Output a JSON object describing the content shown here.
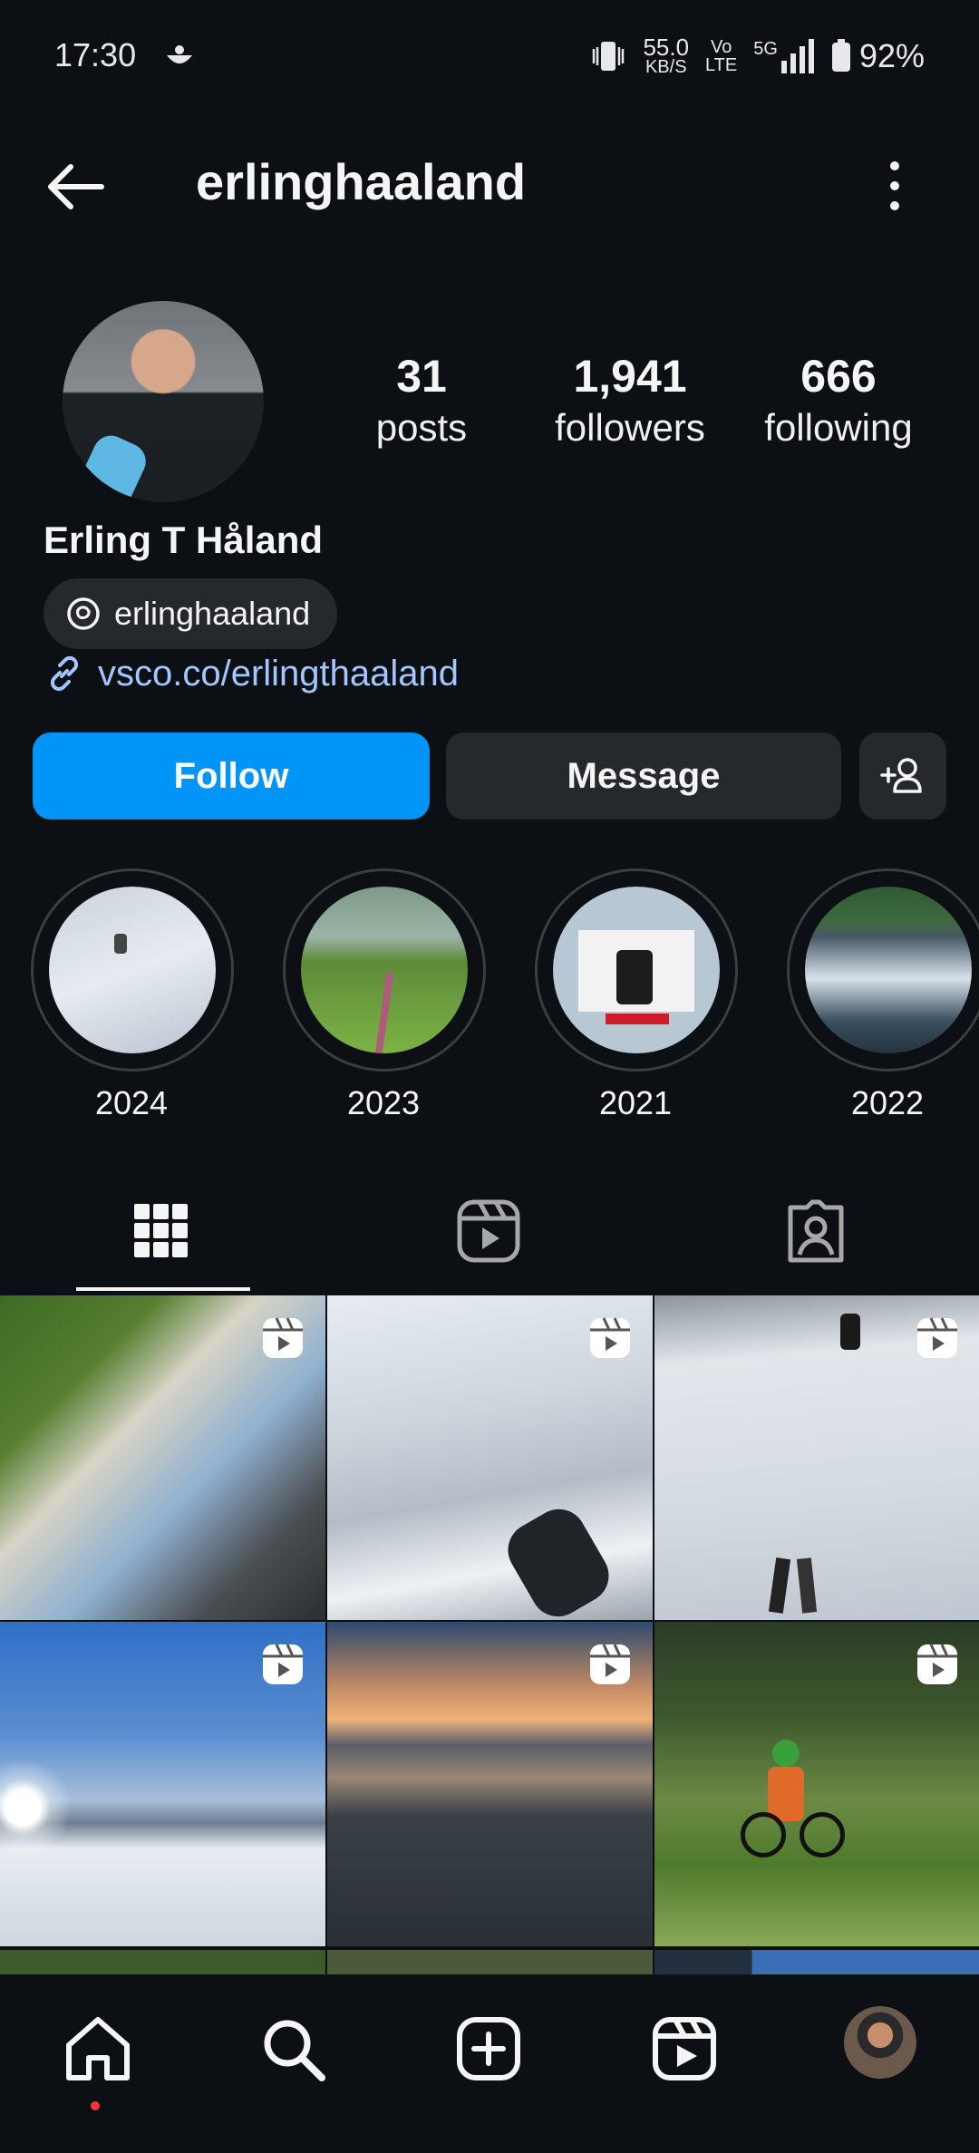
{
  "status_bar": {
    "time": "17:30",
    "net_speed": "55.0",
    "net_unit": "KB/S",
    "volte_top": "Vo",
    "volte_bottom": "LTE",
    "network": "5G",
    "battery": "92%"
  },
  "header": {
    "username": "erlinghaaland"
  },
  "profile": {
    "stats": [
      {
        "value": "31",
        "label": "posts"
      },
      {
        "value": "1,941",
        "label": "followers"
      },
      {
        "value": "666",
        "label": "following"
      }
    ],
    "full_name": "Erling T Håland",
    "threads_handle": "erlinghaaland",
    "link": "vsco.co/erlingthaaland"
  },
  "actions": {
    "follow": "Follow",
    "message": "Message"
  },
  "highlights": [
    {
      "label": "2024"
    },
    {
      "label": "2023"
    },
    {
      "label": "2021"
    },
    {
      "label": "2022"
    }
  ],
  "colors": {
    "background": "#0c1014",
    "accent": "#0095f6",
    "link": "#a3c6ff",
    "notification_dot": "#ff3040"
  },
  "icons": {
    "header": [
      "back-arrow-icon",
      "more-options-icon"
    ],
    "tabs": [
      "grid-icon",
      "reels-icon",
      "tagged-icon"
    ],
    "nav": [
      "home-icon",
      "search-icon",
      "create-icon",
      "reels-icon",
      "profile-avatar"
    ]
  }
}
